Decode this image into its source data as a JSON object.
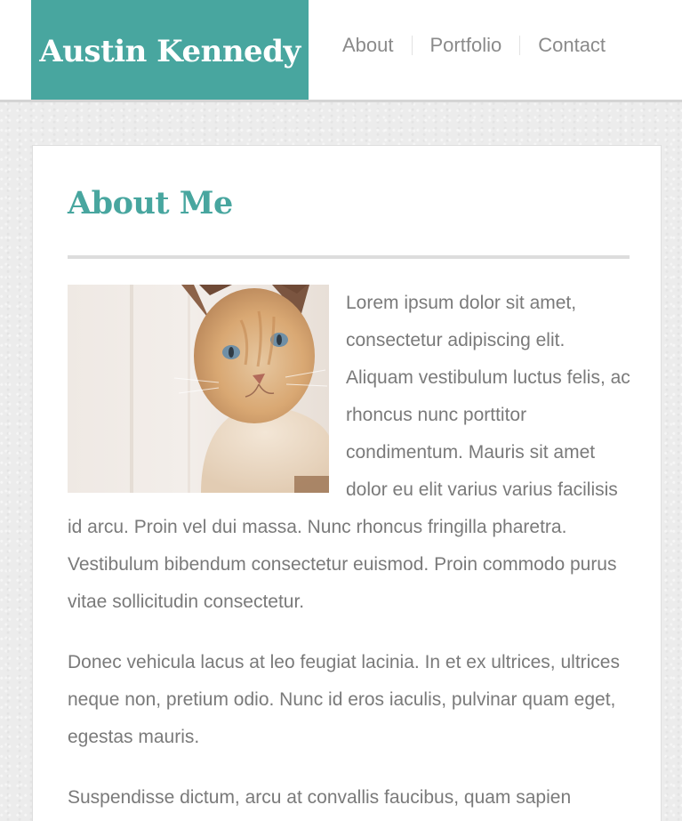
{
  "header": {
    "brand": "Austin Kennedy",
    "nav": [
      "About",
      "Portfolio",
      "Contact"
    ]
  },
  "main": {
    "title": "About Me",
    "paragraphs": [
      "Lorem ipsum dolor sit amet, consectetur adipiscing elit. Aliquam vestibulum luctus felis, ac rhoncus nunc porttitor condimentum. Mauris sit amet dolor eu elit varius varius facilisis id arcu. Proin vel dui massa. Nunc rhoncus fringilla pharetra. Vestibulum bibendum consectetur euismod. Proin commodo purus vitae sollicitudin consectetur.",
      "Donec vehicula lacus at leo feugiat lacinia. In et ex ultrices, ultrices neque non, pretium odio. Nunc id eros iaculis, pulvinar quam eget, egestas mauris.",
      "Suspendisse dictum, arcu at convallis faucibus, quam sapien"
    ]
  },
  "colors": {
    "accent": "#48a69f",
    "text": "#7a7a7a",
    "nav_text": "#8a8a8a"
  },
  "icons": {
    "photo": "cat-photo"
  }
}
